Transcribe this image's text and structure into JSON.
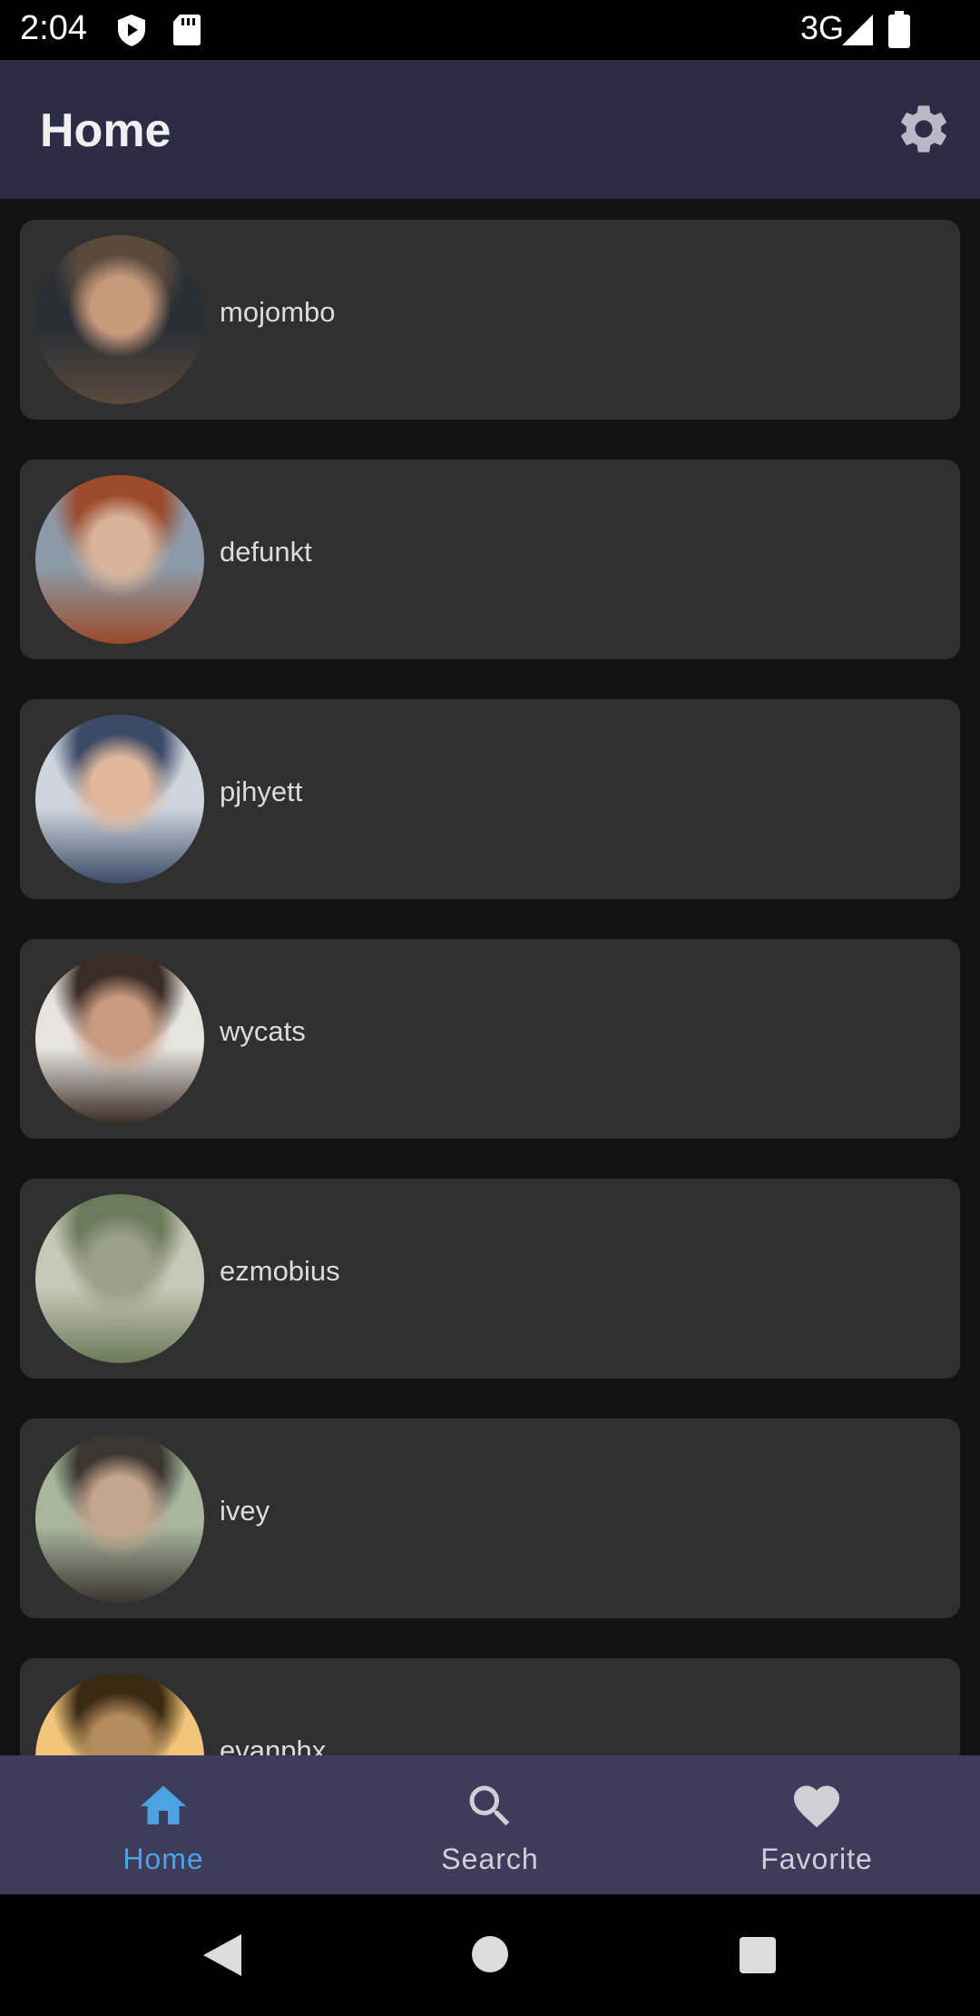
{
  "status_bar": {
    "time": "2:04",
    "network": "3G",
    "icons": [
      "play-protect-icon",
      "sd-card-icon",
      "signal-icon",
      "battery-icon"
    ]
  },
  "app_bar": {
    "title": "Home",
    "settings_icon": "gear-icon"
  },
  "users": [
    {
      "login": "mojombo",
      "avatar_colors": [
        "#5a4a3c",
        "#c79a7e",
        "#2a2f36"
      ]
    },
    {
      "login": "defunkt",
      "avatar_colors": [
        "#9b4a2b",
        "#d8b49a",
        "#8c9aa8"
      ]
    },
    {
      "login": "pjhyett",
      "avatar_colors": [
        "#3b4a66",
        "#e0b89c",
        "#cfd5dc"
      ]
    },
    {
      "login": "wycats",
      "avatar_colors": [
        "#3a2d26",
        "#c99a80",
        "#e7e4df"
      ]
    },
    {
      "login": "ezmobius",
      "avatar_colors": [
        "#6b7a5a",
        "#9aa08a",
        "#c7c9b8"
      ]
    },
    {
      "login": "ivey",
      "avatar_colors": [
        "#3b3530",
        "#c4a58e",
        "#a7b59c"
      ]
    },
    {
      "login": "evanphx",
      "avatar_colors": [
        "#3a2a12",
        "#b68c5e",
        "#f2c57a"
      ]
    }
  ],
  "bottom_nav": {
    "items": [
      {
        "label": "Home",
        "icon": "home-icon",
        "active": true
      },
      {
        "label": "Search",
        "icon": "search-icon",
        "active": false
      },
      {
        "label": "Favorite",
        "icon": "heart-icon",
        "active": false
      }
    ],
    "active_color": "#4ba3e3",
    "inactive_color": "#cfcfd8"
  },
  "system_nav": {
    "icons": [
      "back-icon",
      "home-circle-icon",
      "recents-icon"
    ]
  }
}
